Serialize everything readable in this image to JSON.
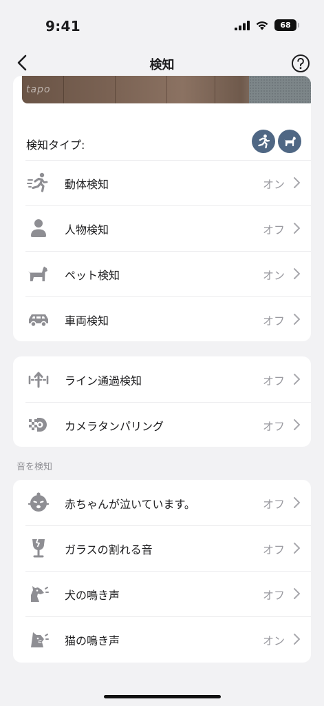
{
  "status_bar": {
    "time": "9:41",
    "battery": "68"
  },
  "nav": {
    "title": "検知",
    "back_icon": "chevron-left-icon",
    "help_icon": "question-circle-icon"
  },
  "preview": {
    "logo": "tapo"
  },
  "detection_types": {
    "label": "検知タイプ:",
    "badges": [
      "running-person-icon",
      "dog-icon"
    ],
    "badge_color": "#4f6784"
  },
  "motion_group": [
    {
      "label": "動体検知",
      "value": "オン",
      "icon": "motion-runner-icon"
    },
    {
      "label": "人物検知",
      "value": "オフ",
      "icon": "person-icon"
    },
    {
      "label": "ペット検知",
      "value": "オン",
      "icon": "pet-dog-icon"
    },
    {
      "label": "車両検知",
      "value": "オフ",
      "icon": "car-icon"
    }
  ],
  "advanced_group": [
    {
      "label": "ライン通過検知",
      "value": "オフ",
      "icon": "line-crossing-icon"
    },
    {
      "label": "カメラタンパリング",
      "value": "オフ",
      "icon": "camera-tamper-icon"
    }
  ],
  "sound_section": {
    "header": "音を検知",
    "items": [
      {
        "label": "赤ちゃんが泣いています。",
        "value": "オフ",
        "icon": "baby-crying-icon"
      },
      {
        "label": "ガラスの割れる音",
        "value": "オフ",
        "icon": "broken-glass-icon"
      },
      {
        "label": "犬の鳴き声",
        "value": "オフ",
        "icon": "dog-bark-icon"
      },
      {
        "label": "猫の鳴き声",
        "value": "オン",
        "icon": "cat-meow-icon"
      }
    ]
  },
  "colors": {
    "background": "#f2f2f4",
    "icon_gray": "#8e8e93",
    "value_gray": "#9a9aa0"
  }
}
